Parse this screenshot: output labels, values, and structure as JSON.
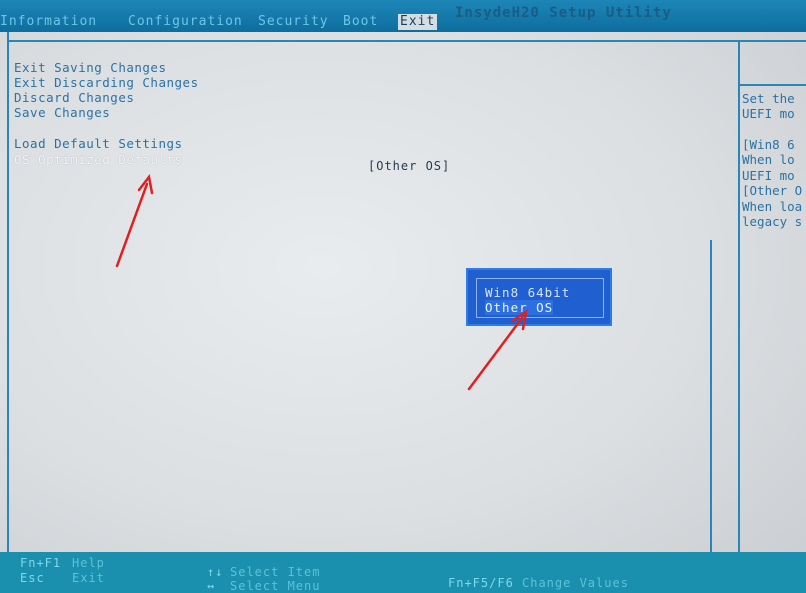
{
  "app": {
    "title": "InsydeH20 Setup Utility"
  },
  "menu": {
    "tabs": [
      {
        "label": "Information"
      },
      {
        "label": "Configuration"
      },
      {
        "label": "Security"
      },
      {
        "label": "Boot"
      },
      {
        "label": "Exit"
      }
    ],
    "active": "Exit"
  },
  "main": {
    "items": [
      {
        "label": "Exit Saving Changes"
      },
      {
        "label": "Exit Discarding Changes"
      },
      {
        "label": "Discard Changes"
      },
      {
        "label": "Save Changes"
      },
      {
        "label": "Load Default Settings"
      },
      {
        "label": "OS Optimized Defaults"
      }
    ],
    "current_value": "[Other OS]"
  },
  "help": {
    "lines": [
      "Set the",
      "UEFI mo",
      "[Win8 6",
      "When lo",
      "UEFI mo",
      "[Other O",
      "When loa",
      "legacy s"
    ]
  },
  "popup": {
    "options": [
      {
        "label": "Win8 64bit"
      },
      {
        "label": "Other OS"
      }
    ],
    "selected": "Other OS"
  },
  "status": {
    "help_key": "Fn+F1",
    "help_desc": "Help",
    "exit_key": "Esc",
    "exit_desc": "Exit",
    "select_item_key": "↑↓",
    "select_item_desc": "Select Item",
    "select_menu_key": "↔",
    "select_menu_desc": "Select Menu",
    "change_key": "Fn+F5/F6",
    "change_desc": "Change Values"
  },
  "colors": {
    "menubar": "#1586b7",
    "background": "#e3e6e8",
    "text": "#2a72a3",
    "popup": "#1f5fd0",
    "statusbar": "#1b8fae",
    "annotation": "#e02020"
  }
}
